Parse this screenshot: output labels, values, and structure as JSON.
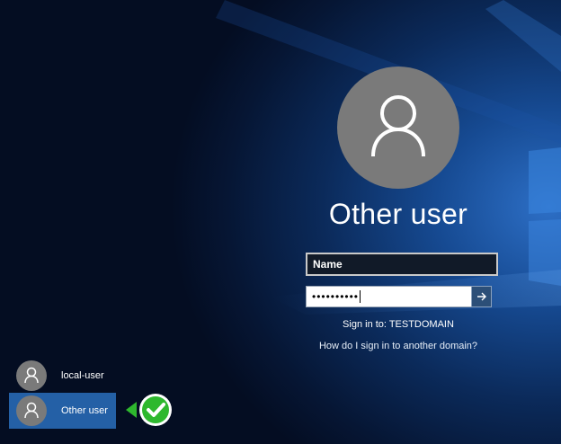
{
  "login": {
    "selected_user": "Other user",
    "name_placeholder": "Name",
    "password_masked": "••••••••••",
    "signin_to": "Sign in to: TESTDOMAIN",
    "help_link": "How do I sign in to another domain?"
  },
  "user_list": [
    {
      "label": "local-user",
      "selected": false
    },
    {
      "label": "Other user",
      "selected": true
    }
  ],
  "icons": {
    "avatar": "user-silhouette-icon",
    "submit": "arrow-right-icon",
    "badge": "green-checkmark-icon"
  },
  "colors": {
    "selected_item": "#2460a6",
    "badge_green": "#2eb82e"
  }
}
